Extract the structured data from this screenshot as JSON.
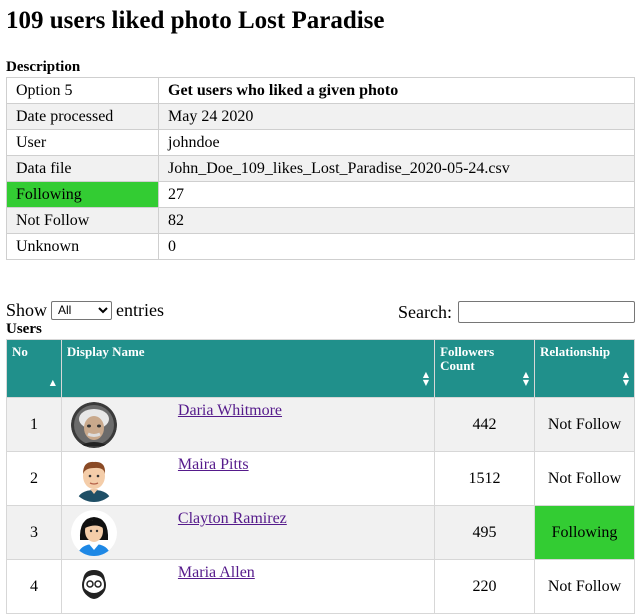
{
  "title": "109 users liked photo Lost Paradise",
  "description": {
    "caption": "Description",
    "rows": [
      {
        "key": "Option 5",
        "value": "Get users who liked a given photo"
      },
      {
        "key": "Date processed",
        "value": "May 24 2020"
      },
      {
        "key": "User",
        "value": "johndoe"
      },
      {
        "key": "Data file",
        "value": "John_Doe_109_likes_Lost_Paradise_2020-05-24.csv"
      },
      {
        "key": "Following",
        "value": "27"
      },
      {
        "key": "Not Follow",
        "value": "82"
      },
      {
        "key": "Unknown",
        "value": "0"
      }
    ],
    "highlight_color": "#33cc33"
  },
  "controls": {
    "show_label": "Show",
    "entries_label": "entries",
    "entries_selected": "All",
    "search_label": "Search:",
    "search_value": ""
  },
  "users": {
    "caption": "Users",
    "header_color": "#20908b",
    "columns": [
      "No",
      "Display Name",
      "Followers Count",
      "Relationship"
    ],
    "rows": [
      {
        "no": "1",
        "name": "Daria Whitmore",
        "followers": "442",
        "relationship": "Not Follow",
        "avatar": "einstein-avatar-icon"
      },
      {
        "no": "2",
        "name": "Maira Pitts",
        "followers": "1512",
        "relationship": "Not Follow",
        "avatar": "man-avatar-icon"
      },
      {
        "no": "3",
        "name": "Clayton Ramirez",
        "followers": "495",
        "relationship": "Following",
        "avatar": "woman-avatar-icon"
      },
      {
        "no": "4",
        "name": "Maria Allen",
        "followers": "220",
        "relationship": "Not Follow",
        "avatar": "bearded-man-avatar-icon"
      }
    ]
  }
}
